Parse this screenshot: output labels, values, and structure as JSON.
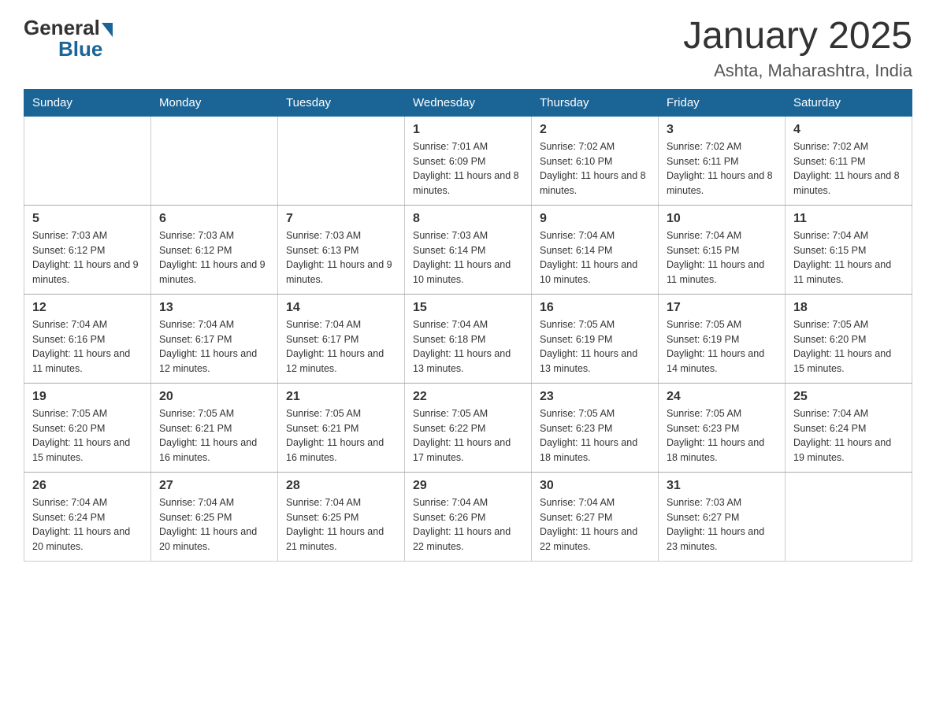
{
  "header": {
    "logo_general": "General",
    "logo_blue": "Blue",
    "title": "January 2025",
    "subtitle": "Ashta, Maharashtra, India"
  },
  "days_of_week": [
    "Sunday",
    "Monday",
    "Tuesday",
    "Wednesday",
    "Thursday",
    "Friday",
    "Saturday"
  ],
  "weeks": [
    [
      {
        "day": "",
        "info": ""
      },
      {
        "day": "",
        "info": ""
      },
      {
        "day": "",
        "info": ""
      },
      {
        "day": "1",
        "info": "Sunrise: 7:01 AM\nSunset: 6:09 PM\nDaylight: 11 hours and 8 minutes."
      },
      {
        "day": "2",
        "info": "Sunrise: 7:02 AM\nSunset: 6:10 PM\nDaylight: 11 hours and 8 minutes."
      },
      {
        "day": "3",
        "info": "Sunrise: 7:02 AM\nSunset: 6:11 PM\nDaylight: 11 hours and 8 minutes."
      },
      {
        "day": "4",
        "info": "Sunrise: 7:02 AM\nSunset: 6:11 PM\nDaylight: 11 hours and 8 minutes."
      }
    ],
    [
      {
        "day": "5",
        "info": "Sunrise: 7:03 AM\nSunset: 6:12 PM\nDaylight: 11 hours and 9 minutes."
      },
      {
        "day": "6",
        "info": "Sunrise: 7:03 AM\nSunset: 6:12 PM\nDaylight: 11 hours and 9 minutes."
      },
      {
        "day": "7",
        "info": "Sunrise: 7:03 AM\nSunset: 6:13 PM\nDaylight: 11 hours and 9 minutes."
      },
      {
        "day": "8",
        "info": "Sunrise: 7:03 AM\nSunset: 6:14 PM\nDaylight: 11 hours and 10 minutes."
      },
      {
        "day": "9",
        "info": "Sunrise: 7:04 AM\nSunset: 6:14 PM\nDaylight: 11 hours and 10 minutes."
      },
      {
        "day": "10",
        "info": "Sunrise: 7:04 AM\nSunset: 6:15 PM\nDaylight: 11 hours and 11 minutes."
      },
      {
        "day": "11",
        "info": "Sunrise: 7:04 AM\nSunset: 6:15 PM\nDaylight: 11 hours and 11 minutes."
      }
    ],
    [
      {
        "day": "12",
        "info": "Sunrise: 7:04 AM\nSunset: 6:16 PM\nDaylight: 11 hours and 11 minutes."
      },
      {
        "day": "13",
        "info": "Sunrise: 7:04 AM\nSunset: 6:17 PM\nDaylight: 11 hours and 12 minutes."
      },
      {
        "day": "14",
        "info": "Sunrise: 7:04 AM\nSunset: 6:17 PM\nDaylight: 11 hours and 12 minutes."
      },
      {
        "day": "15",
        "info": "Sunrise: 7:04 AM\nSunset: 6:18 PM\nDaylight: 11 hours and 13 minutes."
      },
      {
        "day": "16",
        "info": "Sunrise: 7:05 AM\nSunset: 6:19 PM\nDaylight: 11 hours and 13 minutes."
      },
      {
        "day": "17",
        "info": "Sunrise: 7:05 AM\nSunset: 6:19 PM\nDaylight: 11 hours and 14 minutes."
      },
      {
        "day": "18",
        "info": "Sunrise: 7:05 AM\nSunset: 6:20 PM\nDaylight: 11 hours and 15 minutes."
      }
    ],
    [
      {
        "day": "19",
        "info": "Sunrise: 7:05 AM\nSunset: 6:20 PM\nDaylight: 11 hours and 15 minutes."
      },
      {
        "day": "20",
        "info": "Sunrise: 7:05 AM\nSunset: 6:21 PM\nDaylight: 11 hours and 16 minutes."
      },
      {
        "day": "21",
        "info": "Sunrise: 7:05 AM\nSunset: 6:21 PM\nDaylight: 11 hours and 16 minutes."
      },
      {
        "day": "22",
        "info": "Sunrise: 7:05 AM\nSunset: 6:22 PM\nDaylight: 11 hours and 17 minutes."
      },
      {
        "day": "23",
        "info": "Sunrise: 7:05 AM\nSunset: 6:23 PM\nDaylight: 11 hours and 18 minutes."
      },
      {
        "day": "24",
        "info": "Sunrise: 7:05 AM\nSunset: 6:23 PM\nDaylight: 11 hours and 18 minutes."
      },
      {
        "day": "25",
        "info": "Sunrise: 7:04 AM\nSunset: 6:24 PM\nDaylight: 11 hours and 19 minutes."
      }
    ],
    [
      {
        "day": "26",
        "info": "Sunrise: 7:04 AM\nSunset: 6:24 PM\nDaylight: 11 hours and 20 minutes."
      },
      {
        "day": "27",
        "info": "Sunrise: 7:04 AM\nSunset: 6:25 PM\nDaylight: 11 hours and 20 minutes."
      },
      {
        "day": "28",
        "info": "Sunrise: 7:04 AM\nSunset: 6:25 PM\nDaylight: 11 hours and 21 minutes."
      },
      {
        "day": "29",
        "info": "Sunrise: 7:04 AM\nSunset: 6:26 PM\nDaylight: 11 hours and 22 minutes."
      },
      {
        "day": "30",
        "info": "Sunrise: 7:04 AM\nSunset: 6:27 PM\nDaylight: 11 hours and 22 minutes."
      },
      {
        "day": "31",
        "info": "Sunrise: 7:03 AM\nSunset: 6:27 PM\nDaylight: 11 hours and 23 minutes."
      },
      {
        "day": "",
        "info": ""
      }
    ]
  ]
}
